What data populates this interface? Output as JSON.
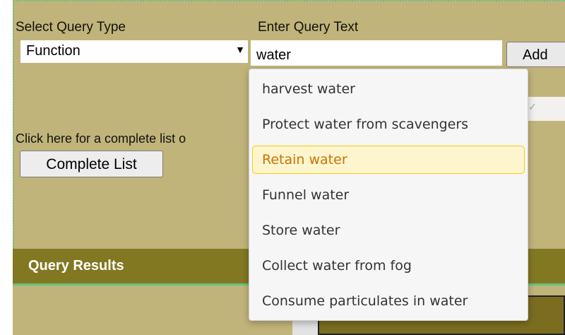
{
  "query": {
    "type_label": "Select Query Type",
    "type_value": "Function",
    "text_label": "Enter Query Text",
    "text_value": "water",
    "add_label": "Add",
    "complete_hint": "Click here for a complete list o",
    "complete_button": "Complete List"
  },
  "results": {
    "title": "Query Results"
  },
  "autocomplete": {
    "options": [
      "harvest water",
      "Protect water from scavengers",
      "Retain water",
      "Funnel water",
      "Store water",
      "Collect water from fog",
      "Consume particulates in water"
    ],
    "highlighted": "Retain water"
  },
  "colors": {
    "panel": "#c1b47a",
    "header": "#837822",
    "highlight_bg": "#fdf5ce",
    "highlight_border": "#fbcb09",
    "highlight_text": "#c77405"
  },
  "icons": {
    "select_arrow": "caret-down-icon",
    "hidden_field_mark": "check-icon"
  }
}
